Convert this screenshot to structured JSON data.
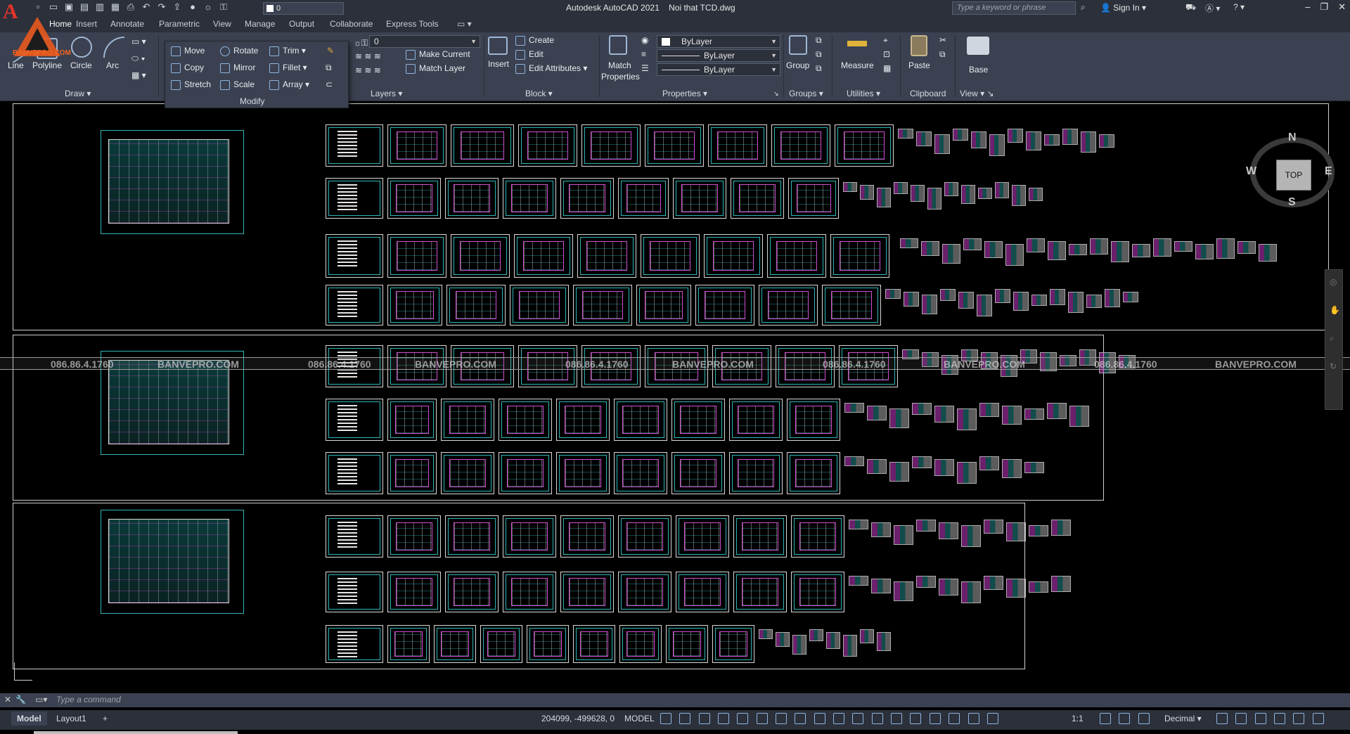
{
  "titlebar": {
    "app_name": "Autodesk AutoCAD 2021",
    "file_name": "Noi that TCD.dwg",
    "current_layer": "0",
    "search_placeholder": "Type a keyword or phrase",
    "sign_in": "Sign In",
    "watermark_logo": "BANVEPRO.COM"
  },
  "tabs": [
    "Home",
    "Insert",
    "Annotate",
    "Parametric",
    "View",
    "Manage",
    "Output",
    "Collaborate",
    "Express Tools"
  ],
  "ribbon": {
    "draw": {
      "label": "Draw",
      "line": "Line",
      "polyline": "Polyline",
      "circle": "Circle",
      "arc": "Arc"
    },
    "modify": {
      "label": "Modify",
      "move": "Move",
      "rotate": "Rotate",
      "trim": "Trim",
      "copy": "Copy",
      "mirror": "Mirror",
      "fillet": "Fillet",
      "stretch": "Stretch",
      "scale": "Scale",
      "array": "Array"
    },
    "layers": {
      "label": "Layers",
      "layer_value": "0",
      "make_current": "Make Current",
      "match_layer": "Match Layer"
    },
    "block": {
      "label": "Block",
      "insert": "Insert",
      "create": "Create",
      "edit": "Edit",
      "edit_attributes": "Edit Attributes"
    },
    "properties": {
      "label": "Properties",
      "match_properties_1": "Match",
      "match_properties_2": "Properties",
      "color": "ByLayer",
      "linetype": "ByLayer",
      "lineweight": "ByLayer"
    },
    "groups": {
      "label": "Groups",
      "group": "Group"
    },
    "utilities": {
      "label": "Utilities",
      "measure": "Measure"
    },
    "clipboard": {
      "label": "Clipboard",
      "paste": "Paste"
    },
    "view": {
      "label": "View",
      "base": "Base"
    }
  },
  "viewcube": {
    "face": "TOP",
    "north": "N",
    "south": "S",
    "east": "E",
    "west": "W"
  },
  "watermark": {
    "phone": "086.86.4.1760",
    "site": "BANVEPRO.COM"
  },
  "commandline": {
    "placeholder": "Type a command"
  },
  "statusbar": {
    "model_tab": "Model",
    "layout_tab": "Layout1",
    "add_tab": "+",
    "coordinates": "204099, -499628, 0",
    "space": "MODEL",
    "scale": "1:1",
    "units": "Decimal"
  }
}
